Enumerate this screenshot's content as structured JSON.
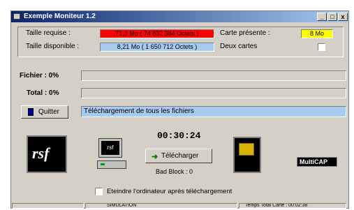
{
  "window": {
    "title": "Exemple Moniteur 1.2",
    "buttons": {
      "minimize": "_",
      "maximize": "□",
      "close": "x"
    }
  },
  "info": {
    "required_label": "Taille requise :",
    "required_value": "71,3 Mo ( 74 832 384 Octets )",
    "available_label": "Taille disponible :",
    "available_value": "8,21 Mo ( 1 650 712 Octets )",
    "card_present_label": "Carte présente :",
    "card_present_value": "8 Mo",
    "two_cards_label": "Deux cartes"
  },
  "progress": {
    "file_label": "Fichier : 0%",
    "file_value": 0,
    "total_label": "Total : 0%",
    "total_value": 0
  },
  "actions": {
    "quit_label": "Quitter",
    "download_label": "Télécharger"
  },
  "status_message": "Téléchargement de tous les fichiers",
  "timer": "00:30:24",
  "bad_block": "Bad Block : 0",
  "logos": {
    "rsf": "rsf",
    "computer": "rsf",
    "multicap": "MultiCAP"
  },
  "option": {
    "shutdown_label": "Eteindre l'ordinateur après téléchargement",
    "shutdown_checked": false
  },
  "statusbar": {
    "left": "",
    "middle": "SIMULATION",
    "right": "Temps Total Carte : 00:02:38"
  },
  "colors": {
    "required": "#ff0000",
    "available": "#a6caf0",
    "card": "#ffff00",
    "status": "#a6caf0",
    "titlebar": "#0a246a"
  }
}
